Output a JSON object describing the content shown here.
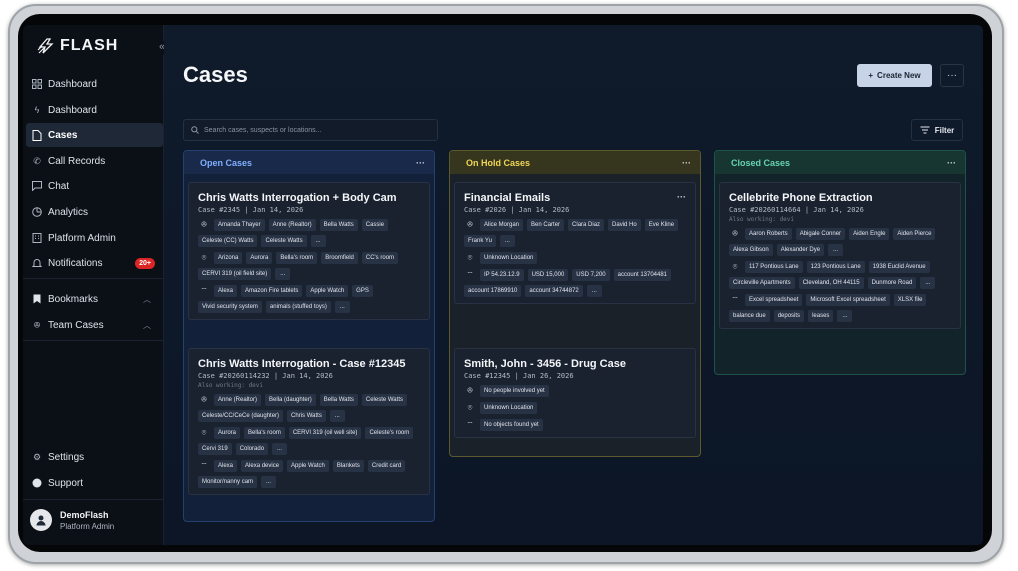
{
  "app": {
    "name": "FLASH"
  },
  "sidebar": {
    "collapse_glyph": "«",
    "items": [
      {
        "label": "Dashboard",
        "icon": "grid-icon"
      },
      {
        "label": "Dashboard",
        "icon": "bolt-icon"
      },
      {
        "label": "Cases",
        "icon": "file-icon",
        "active": true
      },
      {
        "label": "Call Records",
        "icon": "phone-icon"
      },
      {
        "label": "Chat",
        "icon": "chat-icon"
      },
      {
        "label": "Analytics",
        "icon": "pie-icon"
      },
      {
        "label": "Platform Admin",
        "icon": "building-icon"
      },
      {
        "label": "Notifications",
        "icon": "bell-icon",
        "badge": "20+"
      },
      {
        "label": "Bookmarks",
        "icon": "bookmark-icon"
      },
      {
        "label": "Team Cases",
        "icon": "team-icon"
      }
    ],
    "settings_label": "Settings",
    "support_label": "Support",
    "user": {
      "name": "DemoFlash",
      "role": "Platform Admin"
    }
  },
  "page": {
    "title": "Cases",
    "create_label": "Create New",
    "search_placeholder": "Search cases, suspects or locations...",
    "filter_label": "Filter"
  },
  "columns": {
    "open": {
      "title": "Open Cases"
    },
    "hold": {
      "title": "On Hold Cases"
    },
    "closed": {
      "title": "Closed Cases"
    }
  },
  "cards": {
    "c1": {
      "title": "Chris Watts Interrogation + Body Cam",
      "meta": "Case #2345 | Jan 14, 2026",
      "people": [
        "Amanda Thayer",
        "Anne (Realtor)",
        "Bella Watts",
        "Cassie",
        "Celeste (CC) Watts",
        "Celeste Watts"
      ],
      "locations": [
        "Arizona",
        "Aurora",
        "Bella's room",
        "Broomfield",
        "CC's room",
        "CERVI 319 (oil field site)"
      ],
      "objects": [
        "Alexa",
        "Amazon Fire tablets",
        "Apple Watch",
        "GPS",
        "Vivid security system",
        "animals (stuffed toys)"
      ]
    },
    "c2": {
      "title": "Chris Watts Interrogation - Case #12345",
      "meta": "Case #20260114232 | Jan 14, 2026",
      "also": "Also working: devi",
      "people": [
        "Anne (Realtor)",
        "Bella (daughter)",
        "Bella Watts",
        "Celeste Watts",
        "Celeste/CC/CeCe (daughter)",
        "Chris Watts"
      ],
      "locations": [
        "Aurora",
        "Bella's room",
        "CERVI 319 (oil well site)",
        "Celeste's room",
        "Cervi 319",
        "Colorado"
      ],
      "objects": [
        "Alexa",
        "Alexa device",
        "Apple Watch",
        "Blankets",
        "Credit card",
        "Monitor/nanny cam"
      ]
    },
    "c3": {
      "title": "Financial Emails",
      "meta": "Case #2026 | Jan 14, 2026",
      "people": [
        "Alice Morgan",
        "Ben Carter",
        "Clara Diaz",
        "David Ho",
        "Eve Kline",
        "Frank Yu"
      ],
      "locations": [
        "Unknown Location"
      ],
      "objects": [
        "IP 54.23.12.9",
        "USD 15,000",
        "USD 7,200",
        "account 13704481",
        "account 17869910",
        "account 34744872"
      ]
    },
    "c4": {
      "title": "Smith, John - 3456 - Drug Case",
      "meta": "Case #12345 | Jan 26, 2026",
      "people_empty": "No people involved yet",
      "locations": [
        "Unknown Location"
      ],
      "objects_empty": "No objects found yet"
    },
    "c5": {
      "title": "Cellebrite Phone Extraction",
      "meta": "Case #20260114664 | Jan 14, 2026",
      "also": "Also working: devi",
      "people": [
        "Aaron Roberts",
        "Abigale Conner",
        "Aiden Engle",
        "Aiden Pierce",
        "Alexa Gibson",
        "Alexander Dye"
      ],
      "locations": [
        "117 Pontious Lane",
        "123 Pontious Lane",
        "1938 Euclid Avenue",
        "Circleville Apartments",
        "Cleveland, OH 44115",
        "Dunmore Road"
      ],
      "objects": [
        "Excel spreadsheet",
        "Microsoft Excel spreadsheet",
        "XLSX file",
        "balance due",
        "deposits",
        "leases"
      ]
    }
  },
  "more_tag": "..."
}
